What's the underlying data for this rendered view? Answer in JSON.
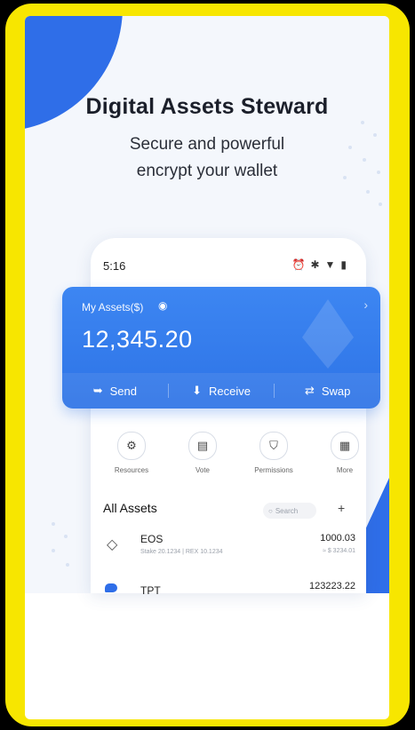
{
  "promo": {
    "headline": "Digital Assets Steward",
    "subline_1": "Secure and powerful",
    "subline_2": "encrypt your wallet"
  },
  "status_bar": {
    "time": "5:16",
    "icons": [
      "alarm-icon",
      "bluetooth-icon",
      "wifi-icon",
      "battery-icon"
    ]
  },
  "assets_card": {
    "label": "My Assets($)",
    "amount": "12,345.20",
    "actions": [
      {
        "label": "Send",
        "icon": "send-icon"
      },
      {
        "label": "Receive",
        "icon": "receive-icon"
      },
      {
        "label": "Swap",
        "icon": "swap-icon"
      }
    ]
  },
  "quick_actions": [
    {
      "label": "Resources",
      "icon": "resources-icon"
    },
    {
      "label": "Vote",
      "icon": "vote-icon"
    },
    {
      "label": "Permissions",
      "icon": "shield-icon"
    },
    {
      "label": "More",
      "icon": "grid-icon"
    }
  ],
  "asset_list": {
    "title": "All Assets",
    "search_placeholder": "Search",
    "add_label": "+",
    "items": [
      {
        "symbol": "EOS",
        "meta": "Stake 20.1234  |  REX 10.1234",
        "amount": "1000.03",
        "fiat": "≈ $ 3234.01"
      },
      {
        "symbol": "TPT",
        "meta": "",
        "amount": "123223.22",
        "fiat": ""
      }
    ]
  },
  "colors": {
    "accent": "#2f6ee8",
    "frame": "#f7e600",
    "background": "#000000"
  }
}
